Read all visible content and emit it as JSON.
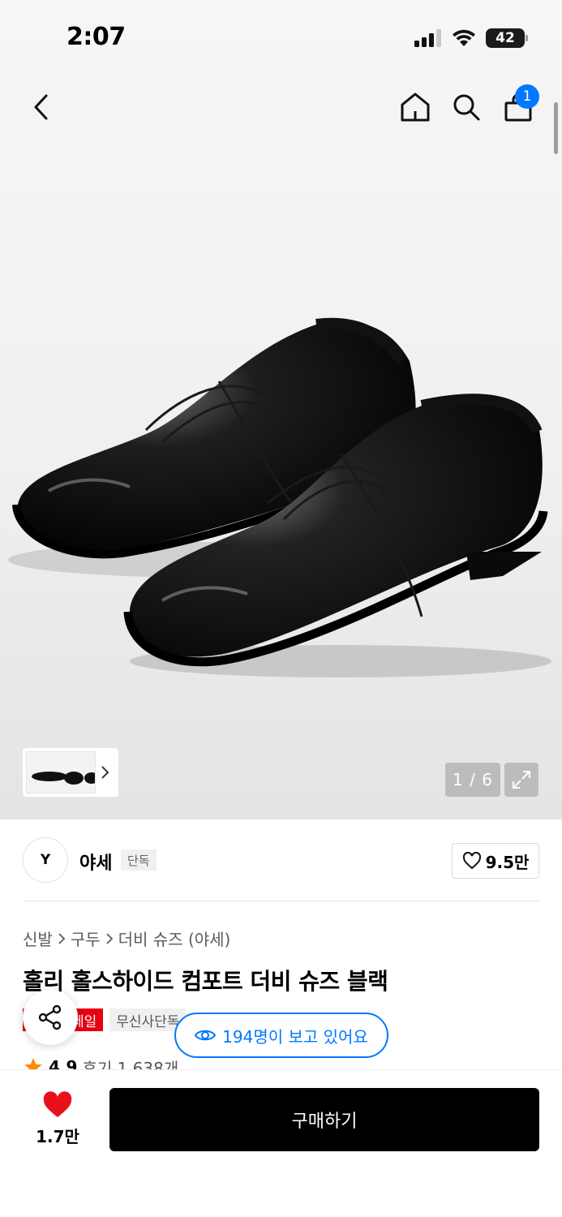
{
  "status_bar": {
    "time": "2:07",
    "battery": "42",
    "icons": [
      "cellular-signal-icon",
      "wifi-icon",
      "battery-icon"
    ]
  },
  "header": {
    "icons": [
      "back-chevron-icon",
      "home-icon",
      "search-icon",
      "shopping-bag-icon"
    ],
    "cart_count": "1"
  },
  "gallery": {
    "counter": "1 / 6",
    "current_index": 1,
    "total": 6,
    "icons": [
      "chevron-right-icon",
      "expand-icon"
    ]
  },
  "brand": {
    "logo_text": "Y",
    "name": "야세",
    "tag": "단독",
    "likes": "9.5만"
  },
  "breadcrumb": [
    "신발",
    "구두",
    "더비 슈즈 (야세)"
  ],
  "product": {
    "title": "홀리 홀스하이드 컴포트 더비 슈즈 블랙",
    "badges": [
      "세일",
      "무신사단독"
    ],
    "rating": "4.9",
    "reviews": "후기 1,638개"
  },
  "viewing": {
    "text": "194명이 보고 있어요"
  },
  "bottom_bar": {
    "like_count": "1.7만",
    "buy_label": "구매하기"
  },
  "colors": {
    "accent_blue": "#0078ff",
    "sale_red": "#e60012",
    "heart_red": "#e8101b",
    "star_orange": "#ff8a00",
    "buy_button": "#000000"
  }
}
